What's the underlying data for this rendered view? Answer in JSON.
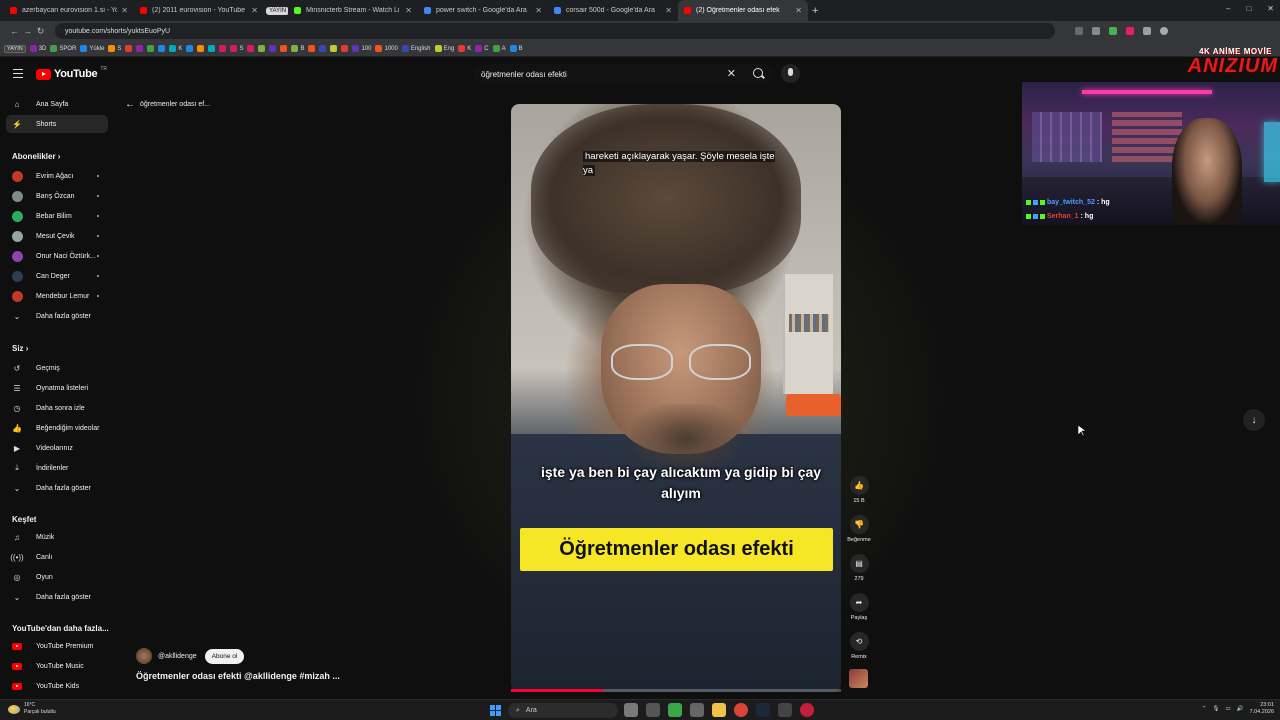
{
  "browser": {
    "tabs": [
      {
        "title": "azerbaycan eurovision 1.si - Yo",
        "color": "#ff0000"
      },
      {
        "title": "(2) 2011 eurovision - YouTube",
        "color": "#ff0000"
      },
      {
        "title": "YAYIN",
        "pill": true
      },
      {
        "title": "Minsnicterb Stream - Watch Li",
        "color": "#53fc18"
      },
      {
        "title": "power switch - Google'da Ara",
        "color": "#4285f4"
      },
      {
        "title": "corsair 500d - Google'da Ara",
        "color": "#4285f4"
      },
      {
        "title": "(2) Öğretmenler odası efek",
        "color": "#ff0000",
        "active": true
      }
    ],
    "url": "youtube.com/shorts/yuktsEuoPyU",
    "bookmarks": [
      "YAYIN",
      "3D",
      "SPOR",
      "Yükle",
      "S",
      "K",
      "S",
      "B",
      "100",
      "1000",
      "English",
      "Eng",
      "K",
      "C",
      "A",
      "B"
    ]
  },
  "youtube": {
    "logo": "YouTube",
    "region": "TR",
    "search_value": "öğretmenler odası efekti",
    "back_label": "öğretmenler odası ef...",
    "sidebar": {
      "main": [
        {
          "label": "Ana Sayfa",
          "icon": "home-icon"
        },
        {
          "label": "Shorts",
          "icon": "shorts-icon",
          "active": true
        }
      ],
      "subs_header": "Abonelikler",
      "subs": [
        {
          "label": "Evrim Ağacı",
          "color": "#c0392b"
        },
        {
          "label": "Barış Özcan",
          "color": "#7f8c8d"
        },
        {
          "label": "Bebar Bilim",
          "color": "#27ae60"
        },
        {
          "label": "Mesut Çevik",
          "color": "#95a5a6"
        },
        {
          "label": "Onur Naci Öztürk...",
          "color": "#8e44ad"
        },
        {
          "label": "Can Deger",
          "color": "#2c3e50"
        },
        {
          "label": "Mendebur Lemur",
          "color": "#c0392b"
        }
      ],
      "show_more": "Daha fazla göster",
      "you_header": "Siz",
      "you": [
        {
          "label": "Geçmiş",
          "icon": "history-icon",
          "glyph": "↺"
        },
        {
          "label": "Oynatma listeleri",
          "icon": "playlist-icon",
          "glyph": "☰"
        },
        {
          "label": "Daha sonra izle",
          "icon": "clock-icon",
          "glyph": "◷"
        },
        {
          "label": "Beğendiğim videolar",
          "icon": "like-icon",
          "glyph": "👍"
        },
        {
          "label": "Videolarınız",
          "icon": "video-icon",
          "glyph": "▶"
        },
        {
          "label": "İndirilenler",
          "icon": "download-icon",
          "glyph": "⤓"
        },
        {
          "label": "Daha fazla göster",
          "icon": "chevron-down-icon",
          "glyph": "⌄"
        }
      ],
      "explore_header": "Keşfet",
      "explore": [
        {
          "label": "Müzik",
          "icon": "music-icon",
          "glyph": "♫"
        },
        {
          "label": "Canlı",
          "icon": "live-icon",
          "glyph": "((•))"
        },
        {
          "label": "Oyun",
          "icon": "gaming-icon",
          "glyph": "◎"
        },
        {
          "label": "Daha fazla göster",
          "icon": "chevron-down-icon",
          "glyph": "⌄"
        }
      ],
      "more_header": "YouTube'dan daha fazla...",
      "more": [
        {
          "label": "YouTube Premium"
        },
        {
          "label": "YouTube Music"
        },
        {
          "label": "YouTube Kids"
        }
      ]
    },
    "video": {
      "caption_top": "hareketi açıklayarak yaşar. Şöyle mesela işte ya",
      "caption_mid": "işte ya ben bi çay alıcaktım ya gidip bi çay alıyım",
      "banner": "Öğretmenler odası efekti",
      "progress": 0.28
    },
    "actions": {
      "likes": "15 B",
      "dislike": "Beğenme",
      "comments": "279",
      "share": "Paylaş",
      "remix": "Remix"
    },
    "channel": {
      "handle": "@akllidenge",
      "subscribe": "Abone ol",
      "title": "Öğretmenler odası efekti @akllidenge #mizah ..."
    }
  },
  "stream_overlay": {
    "logo_tag": "4K ANİME MOVİE",
    "logo_word": "ANIZIUM",
    "chat": [
      {
        "user": "bay_twitch_52",
        "msg": ": hg",
        "color": "#4a9cff"
      },
      {
        "user": "Serhan_1",
        "msg": ": hg",
        "color": "#e2452a"
      }
    ]
  },
  "taskbar": {
    "weather_temp": "16°C",
    "weather_desc": "Parçalı bulutlu",
    "search": "Ara",
    "time": "23:01",
    "date": "7.04.2026"
  }
}
